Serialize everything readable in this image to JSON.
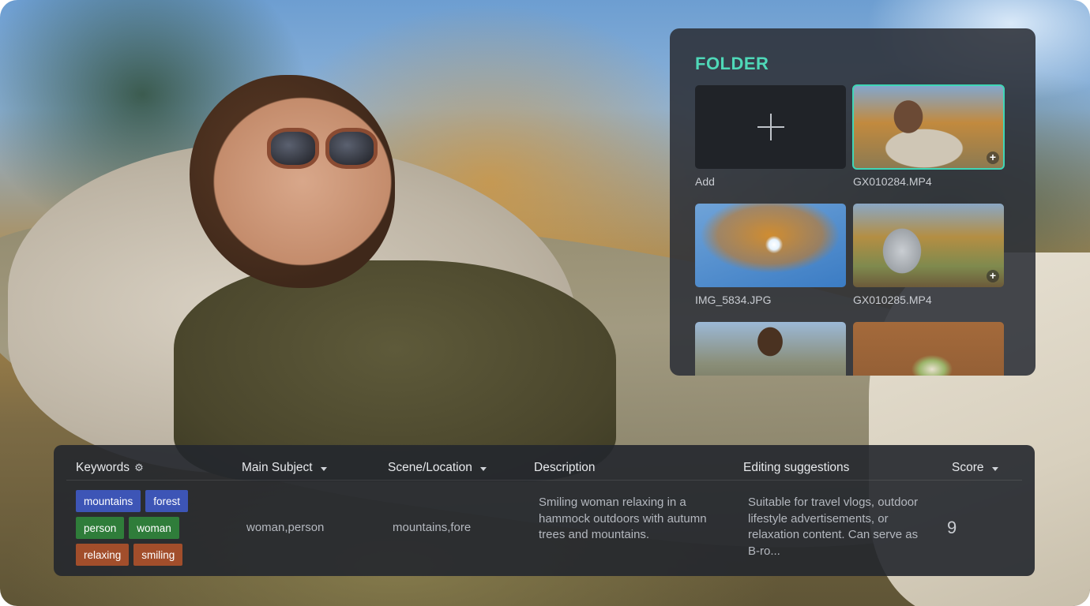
{
  "folder": {
    "title": "FOLDER",
    "items": [
      {
        "label": "Add",
        "kind": "add-button"
      },
      {
        "label": "GX010284.MP4",
        "kind": "video",
        "selected": true
      },
      {
        "label": "IMG_5834.JPG",
        "kind": "image"
      },
      {
        "label": "GX010285.MP4",
        "kind": "video"
      },
      {
        "label": "",
        "kind": "video"
      },
      {
        "label": "",
        "kind": "image"
      }
    ]
  },
  "table": {
    "headers": {
      "keywords": "Keywords",
      "main_subject": "Main Subject",
      "scene_location": "Scene/Location",
      "description": "Description",
      "editing_suggestions": "Editing suggestions",
      "score": "Score"
    },
    "row": {
      "keywords": [
        {
          "text": "mountains",
          "color": "#3d55b6"
        },
        {
          "text": "forest",
          "color": "#3d55b6"
        },
        {
          "text": "person",
          "color": "#2f7d3a"
        },
        {
          "text": "woman",
          "color": "#2f7d3a"
        },
        {
          "text": "relaxing",
          "color": "#a24e2b"
        },
        {
          "text": "smiling",
          "color": "#a24e2b"
        }
      ],
      "main_subject": "woman,person",
      "scene_location": "mountains,fore",
      "description": "Smiling woman relaxing in a hammock outdoors with autumn trees and mountains.",
      "editing_suggestions": "Suitable for travel vlogs, outdoor lifestyle advertisements, or relaxation content. Can serve as B-ro...",
      "score": "9"
    }
  },
  "colors": {
    "accent": "#3fd6b6",
    "panel_bg": "#2c3038"
  }
}
